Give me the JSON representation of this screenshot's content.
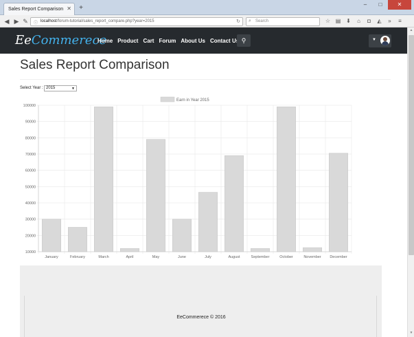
{
  "browser": {
    "tab_title": "Sales Report Comparison",
    "url_host": "localhost",
    "url_path": "/forum-tutorial/sales_report_compare.php?year=2015",
    "search_placeholder": "Search"
  },
  "site": {
    "logo_a": "Ee",
    "logo_b": "Commerece",
    "nav": [
      "Home",
      "Product",
      "Cart",
      "Forum",
      "About Us",
      "Contact Us"
    ]
  },
  "page": {
    "title": "Sales Report Comparison",
    "select_label": "Select Year :",
    "selected_year": "2015"
  },
  "chart_data": {
    "type": "bar",
    "legend": "Earn in Year 2015",
    "categories": [
      "January",
      "February",
      "March",
      "April",
      "May",
      "June",
      "July",
      "August",
      "September",
      "October",
      "November",
      "December"
    ],
    "values": [
      30000,
      25000,
      99000,
      12000,
      79000,
      30000,
      46500,
      69000,
      12000,
      99000,
      12500,
      70500
    ],
    "y_ticks": [
      "10000",
      "20000",
      "30000",
      "40000",
      "50000",
      "60000",
      "70000",
      "80000",
      "90000",
      "100000"
    ],
    "ylim": [
      10000,
      100000
    ],
    "grid": true,
    "bar_color": "#d9d9d9",
    "bar_stroke": "#c8c8c8"
  },
  "footer": {
    "text": "EeCommerece © 2016"
  }
}
